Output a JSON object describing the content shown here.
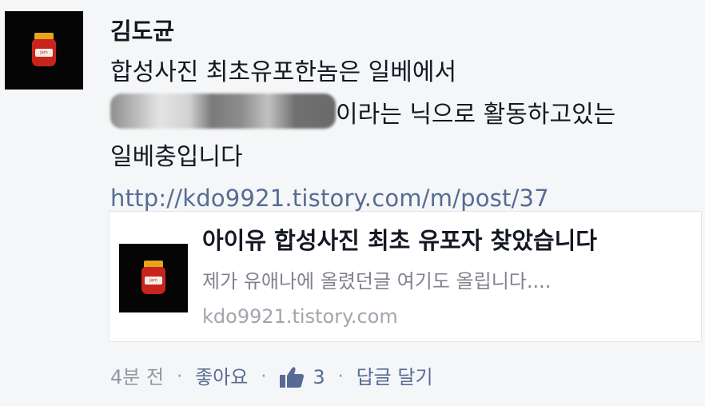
{
  "post": {
    "author": "김도균",
    "line1": "합성사진 최초유포한놈은 일베에서",
    "line2_suffix": "이라는 닉으로 활동하고있는",
    "line3": "일베충입니다",
    "link_url": "http://kdo9921.tistory.com/m/post/37"
  },
  "avatar": {
    "icon": "jam-jar-icon",
    "label": "Jam"
  },
  "link_preview": {
    "title": "아이유 합성사진 최초 유포자 찾았습니다",
    "description": "제가 유애나에 올렸던글 여기도 올립니다....",
    "domain": "kdo9921.tistory.com",
    "thumbnail_icon": "jam-jar-icon",
    "thumbnail_label": "Jam"
  },
  "actions": {
    "time": "4분 전",
    "separator": "·",
    "like_label": "좋아요",
    "like_icon": "thumbs-up-icon",
    "like_count": "3",
    "reply_label": "답글 달기"
  },
  "colors": {
    "background": "#f5f6f7",
    "text": "#141823",
    "link": "#576b95",
    "muted": "#9197a3",
    "card_border": "#e3e5e9"
  }
}
